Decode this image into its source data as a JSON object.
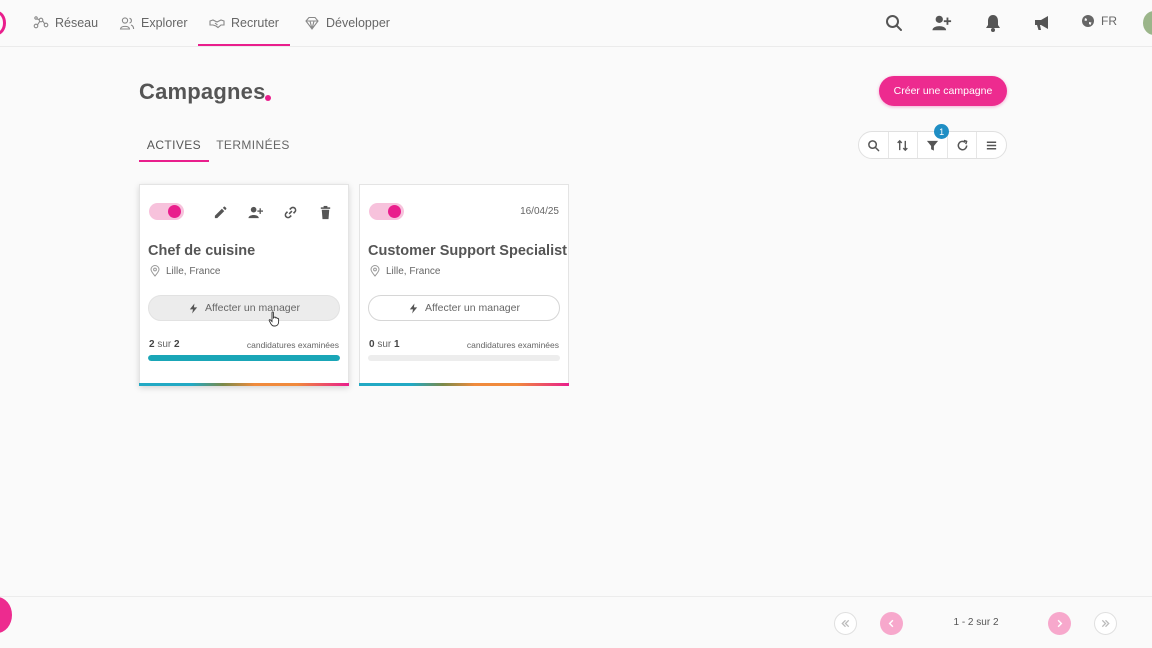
{
  "nav": {
    "items": [
      {
        "label": "Réseau",
        "icon": "network-icon"
      },
      {
        "label": "Explorer",
        "icon": "users-icon"
      },
      {
        "label": "Recruter",
        "icon": "handshake-icon",
        "active": true
      },
      {
        "label": "Développer",
        "icon": "diamond-icon"
      }
    ],
    "language": "FR"
  },
  "page": {
    "title": "Campagnes",
    "create_button": "Créer une campagne"
  },
  "tabs": [
    {
      "label": "ACTIVES",
      "active": true
    },
    {
      "label": "TERMINÉES",
      "active": false
    }
  ],
  "toolbar": {
    "filter_badge": "1"
  },
  "cards": [
    {
      "title": "Chef de cuisine",
      "location": "Lille, France",
      "date": "",
      "assign_label": "Affecter un manager",
      "progress_done": "2",
      "progress_sep": "sur",
      "progress_total": "2",
      "progress_label": "candidatures examinées",
      "progress_fraction": 1.0,
      "active": true
    },
    {
      "title": "Customer Support Specialist",
      "location": "Lille, France",
      "date": "16/04/25",
      "assign_label": "Affecter un manager",
      "progress_done": "0",
      "progress_sep": "sur",
      "progress_total": "1",
      "progress_label": "candidatures examinées",
      "progress_fraction": 0.0,
      "active": true
    }
  ],
  "pagination": {
    "info": "1 - 2 sur 2"
  },
  "colors": {
    "accent": "#e91e8c",
    "progress": "#1aa6b7",
    "badge": "#1f8ec4"
  }
}
